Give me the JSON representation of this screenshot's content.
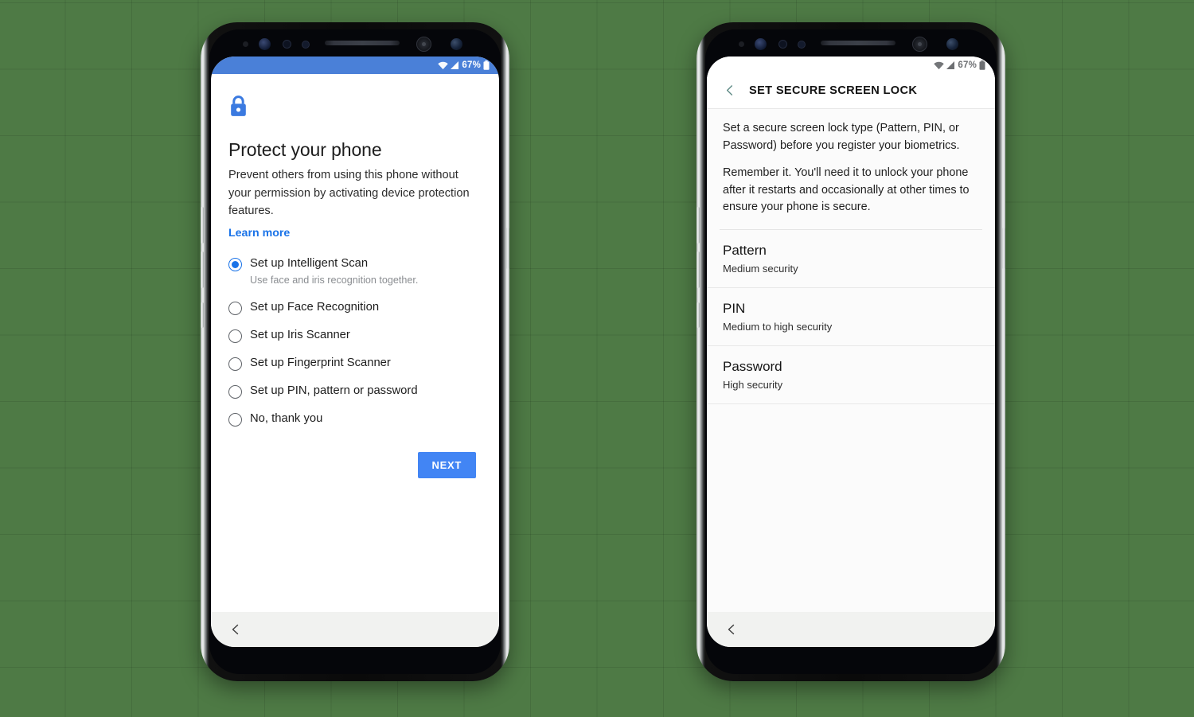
{
  "background": {
    "color": "#4e7a45",
    "grid": true
  },
  "phone_left": {
    "status_bar": {
      "battery": "67%",
      "wifi_icon": "wifi-icon",
      "signal_icon": "signal-icon",
      "battery_icon": "battery-icon",
      "background": "#4a80d8"
    },
    "lock_icon": "lock-icon",
    "title": "Protect your phone",
    "description": "Prevent others from using this phone without your permission by activating device protection features.",
    "learn_more": "Learn more",
    "options": [
      {
        "label": "Set up Intelligent Scan",
        "sub": "Use face and iris recognition together.",
        "selected": true
      },
      {
        "label": "Set up Face Recognition",
        "sub": "",
        "selected": false
      },
      {
        "label": "Set up Iris Scanner",
        "sub": "",
        "selected": false
      },
      {
        "label": "Set up Fingerprint Scanner",
        "sub": "",
        "selected": false
      },
      {
        "label": "Set up PIN, pattern or password",
        "sub": "",
        "selected": false
      },
      {
        "label": "No, thank you",
        "sub": "",
        "selected": false
      }
    ],
    "next_button": "NEXT",
    "nav_back_icon": "back-chevron-icon"
  },
  "phone_right": {
    "status_bar": {
      "battery": "67%",
      "wifi_icon": "wifi-icon",
      "signal_icon": "signal-icon",
      "battery_icon": "battery-icon",
      "background": "#ffffff"
    },
    "header": {
      "back_icon": "back-chevron-icon",
      "title": "SET SECURE SCREEN LOCK"
    },
    "paragraphs": [
      "Set a secure screen lock type (Pattern, PIN, or Password) before you register your biometrics.",
      "Remember it. You'll need it to unlock your phone after it restarts and occasionally at other times to ensure your phone is secure."
    ],
    "lock_types": [
      {
        "title": "Pattern",
        "sub": "Medium security"
      },
      {
        "title": "PIN",
        "sub": "Medium to high security"
      },
      {
        "title": "Password",
        "sub": "High security"
      }
    ],
    "nav_back_icon": "back-chevron-icon"
  },
  "colors": {
    "accent_blue": "#1a73e8",
    "button_blue": "#4285f4",
    "status_blue": "#4a80d8",
    "header_chevron": "#5f8b86"
  }
}
